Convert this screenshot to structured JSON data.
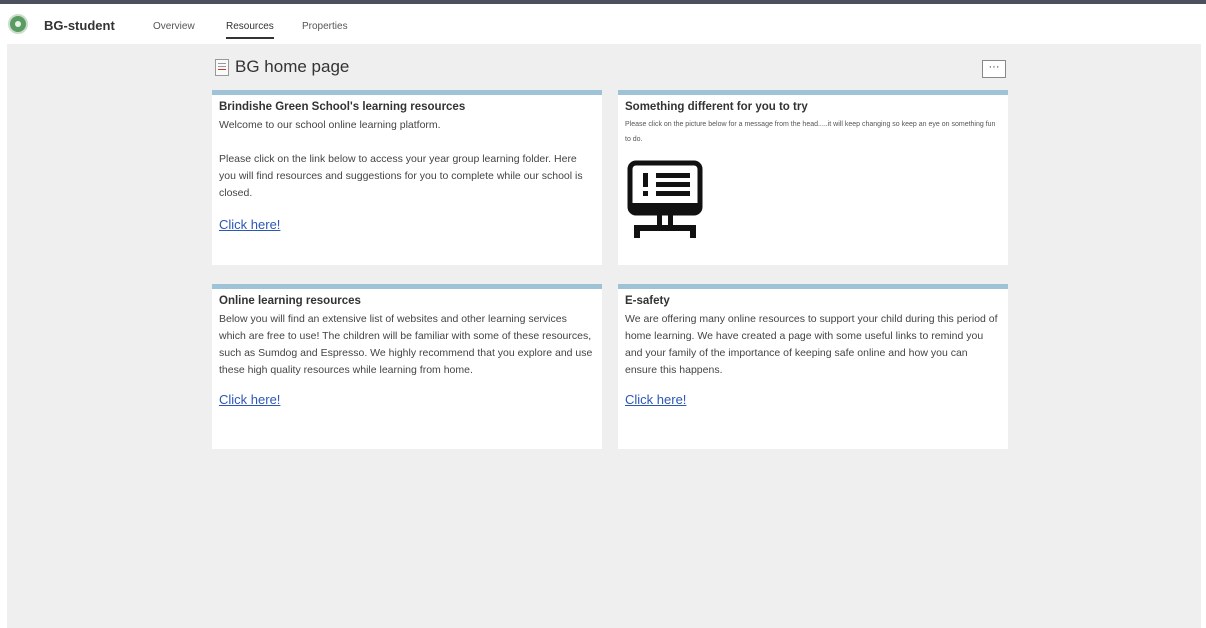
{
  "header": {
    "site_name": "BG-student",
    "tabs": [
      {
        "label": "Overview"
      },
      {
        "label": "Resources"
      },
      {
        "label": "Properties"
      }
    ]
  },
  "page": {
    "title": "BG home page",
    "more_label": "···"
  },
  "cards": [
    {
      "title": "Brindishe Green School's learning resources",
      "intro": "Welcome to our school online learning platform.",
      "body": "Please click on the link below to access your year group learning folder. Here you will find resources and suggestions for you to complete while our school is closed.",
      "link": "Click here!"
    },
    {
      "title": "Something different for you to try",
      "body": "Please click on the picture below for a message from the head.....it will keep changing so keep an eye on something fun to do.",
      "image_icon": "monitor-announcement-icon"
    },
    {
      "title": "Online learning resources",
      "body": "Below you will find an extensive list of websites and other learning services which are free to use! The children will be familiar with some of these resources, such as Sumdog and Espresso. We highly recommend that you explore and use these high quality resources while learning from home.",
      "link": "Click here!"
    },
    {
      "title": "E-safety",
      "body": "We are offering many online resources to support your child during this period of home learning. We have created a page with some useful links to remind you and your family of the importance of keeping safe online and how you can ensure this happens.",
      "link": "Click here!"
    }
  ],
  "colors": {
    "card_accent": "#9ec3d6",
    "link": "#2b57b6",
    "background": "#efefef"
  }
}
